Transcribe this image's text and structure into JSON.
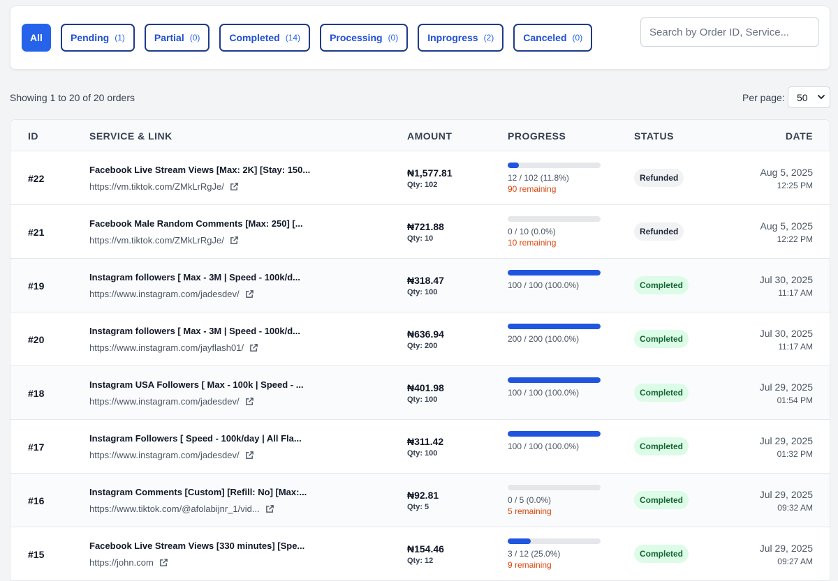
{
  "filters": {
    "tabs": [
      {
        "label": "All",
        "count": ""
      },
      {
        "label": "Pending",
        "count": "(1)"
      },
      {
        "label": "Partial",
        "count": "(0)"
      },
      {
        "label": "Completed",
        "count": "(14)"
      },
      {
        "label": "Processing",
        "count": "(0)"
      },
      {
        "label": "Inprogress",
        "count": "(2)"
      },
      {
        "label": "Canceled",
        "count": "(0)"
      }
    ],
    "search_placeholder": "Search by Order ID, Service..."
  },
  "summary": {
    "showing": "Showing 1 to 20 of 20 orders",
    "per_page_label": "Per page:",
    "per_page_value": "50"
  },
  "table": {
    "headers": [
      "ID",
      "SERVICE & LINK",
      "AMOUNT",
      "PROGRESS",
      "STATUS",
      "DATE"
    ],
    "rows": [
      {
        "id": "#22",
        "service": "Facebook Live Stream Views [Max: 2K] [Stay: 150...",
        "link": "https://vm.tiktok.com/ZMkLrRgJe/",
        "amount": "₦1,577.81",
        "qty": "Qty: 102",
        "progress_fraction": 0.118,
        "progress_text": "12 / 102 (11.8%)",
        "remaining": "90 remaining",
        "status": "Refunded",
        "date": "Aug 5, 2025",
        "time": "12:25 PM"
      },
      {
        "id": "#21",
        "service": "Facebook Male Random Comments [Max: 250] [...",
        "link": "https://vm.tiktok.com/ZMkLrRgJe/",
        "amount": "₦721.88",
        "qty": "Qty: 10",
        "progress_fraction": 0.0,
        "progress_text": "0 / 10 (0.0%)",
        "remaining": "10 remaining",
        "status": "Refunded",
        "date": "Aug 5, 2025",
        "time": "12:22 PM"
      },
      {
        "id": "#19",
        "service": "Instagram followers [ Max - 3M | Speed - 100k/d...",
        "link": "https://www.instagram.com/jadesdev/",
        "amount": "₦318.47",
        "qty": "Qty: 100",
        "progress_fraction": 1.0,
        "progress_text": "100 / 100 (100.0%)",
        "remaining": "",
        "status": "Completed",
        "date": "Jul 30, 2025",
        "time": "11:17 AM"
      },
      {
        "id": "#20",
        "service": "Instagram followers [ Max - 3M | Speed - 100k/d...",
        "link": "https://www.instagram.com/jayflash01/",
        "amount": "₦636.94",
        "qty": "Qty: 200",
        "progress_fraction": 1.0,
        "progress_text": "200 / 200 (100.0%)",
        "remaining": "",
        "status": "Completed",
        "date": "Jul 30, 2025",
        "time": "11:17 AM"
      },
      {
        "id": "#18",
        "service": "Instagram USA Followers [ Max - 100k | Speed - ...",
        "link": "https://www.instagram.com/jadesdev/",
        "amount": "₦401.98",
        "qty": "Qty: 100",
        "progress_fraction": 1.0,
        "progress_text": "100 / 100 (100.0%)",
        "remaining": "",
        "status": "Completed",
        "date": "Jul 29, 2025",
        "time": "01:54 PM"
      },
      {
        "id": "#17",
        "service": "Instagram Followers [ Speed - 100k/day | All Fla...",
        "link": "https://www.instagram.com/jadesdev/",
        "amount": "₦311.42",
        "qty": "Qty: 100",
        "progress_fraction": 1.0,
        "progress_text": "100 / 100 (100.0%)",
        "remaining": "",
        "status": "Completed",
        "date": "Jul 29, 2025",
        "time": "01:32 PM"
      },
      {
        "id": "#16",
        "service": "Instagram Comments [Custom] [Refill: No] [Max:...",
        "link": "https://www.tiktok.com/@afolabijnr_1/vid...",
        "amount": "₦92.81",
        "qty": "Qty: 5",
        "progress_fraction": 0.0,
        "progress_text": "0 / 5 (0.0%)",
        "remaining": "5 remaining",
        "status": "Completed",
        "date": "Jul 29, 2025",
        "time": "09:32 AM"
      },
      {
        "id": "#15",
        "service": "Facebook Live Stream Views [330 minutes] [Spe...",
        "link": "https://john.com",
        "amount": "₦154.46",
        "qty": "Qty: 12",
        "progress_fraction": 0.25,
        "progress_text": "3 / 12 (25.0%)",
        "remaining": "9 remaining",
        "status": "Completed",
        "date": "Jul 29, 2025",
        "time": "09:27 AM"
      }
    ]
  }
}
